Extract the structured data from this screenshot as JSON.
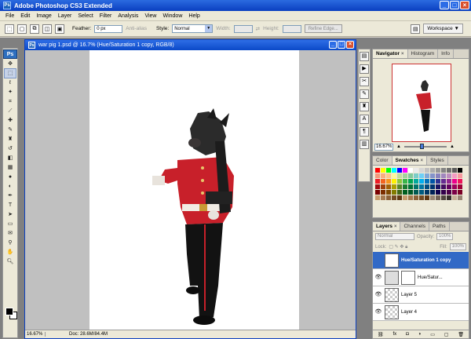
{
  "app": {
    "title": "Adobe Photoshop CS3 Extended",
    "icon": "Ps"
  },
  "menu": [
    "File",
    "Edit",
    "Image",
    "Layer",
    "Select",
    "Filter",
    "Analysis",
    "View",
    "Window",
    "Help"
  ],
  "options": {
    "feather_label": "Feather:",
    "feather_value": "0 px",
    "antialias_label": "Anti-alias",
    "style_label": "Style:",
    "style_value": "Normal",
    "width_label": "Width:",
    "height_label": "Height:",
    "refine_edge": "Refine Edge...",
    "workspace": "Workspace ▼"
  },
  "document": {
    "title": "war pig 1.psd @ 16.7% (Hue/Saturation 1 copy, RGB/8)",
    "zoom": "16.67%",
    "doc_size": "Doc: 28.6M/84.4M"
  },
  "navigator": {
    "tabs": [
      "Navigator",
      "Histogram",
      "Info"
    ],
    "zoom": "16.67%"
  },
  "swatches": {
    "tabs": [
      "Color",
      "Swatches",
      "Styles"
    ],
    "colors": [
      "#ff0000",
      "#ffff00",
      "#00ff00",
      "#00ffff",
      "#0000ff",
      "#ff00ff",
      "#ffffff",
      "#ebebeb",
      "#d6d6d6",
      "#c2c2c2",
      "#adadad",
      "#999999",
      "#858585",
      "#707070",
      "#5c5c5c",
      "#000000",
      "#f7977a",
      "#f9ad81",
      "#fdc68a",
      "#fff79a",
      "#c4df9b",
      "#a2d39c",
      "#82ca9d",
      "#7bcdc8",
      "#6ecff6",
      "#7ea7d8",
      "#8493ca",
      "#8882be",
      "#a187be",
      "#bc8dbf",
      "#f49ac2",
      "#f6989d",
      "#ed1c24",
      "#f26522",
      "#f7941d",
      "#fff200",
      "#8dc63f",
      "#39b54a",
      "#00a651",
      "#00a99d",
      "#00aeef",
      "#0072bc",
      "#0054a6",
      "#2e3192",
      "#662d91",
      "#92278f",
      "#ec008c",
      "#ed145b",
      "#9e0b0f",
      "#a0410d",
      "#a36209",
      "#aba000",
      "#598527",
      "#1a7b30",
      "#007236",
      "#00746b",
      "#0076a3",
      "#004b80",
      "#003471",
      "#1b1464",
      "#440e62",
      "#630460",
      "#9e005d",
      "#9e0039",
      "#790000",
      "#7b2e00",
      "#7d4900",
      "#827b00",
      "#406618",
      "#005e20",
      "#005826",
      "#005952",
      "#005b7f",
      "#003663",
      "#002157",
      "#0d004c",
      "#32004b",
      "#4b0049",
      "#7b0046",
      "#7a0026",
      "#c69c6d",
      "#a67c52",
      "#8c6239",
      "#754c24",
      "#603813",
      "#c69c6d",
      "#a67c52",
      "#8c6239",
      "#754c24",
      "#603813",
      "#998675",
      "#736357",
      "#534741",
      "#362f2d",
      "#c7b299",
      "#998675"
    ]
  },
  "layers": {
    "tabs": [
      "Layers",
      "Channels",
      "Paths"
    ],
    "blend_mode": "Normal",
    "opacity_label": "Opacity:",
    "opacity_value": "100%",
    "lock_label": "Lock:",
    "fill_label": "Fill:",
    "fill_value": "100%",
    "rows": [
      {
        "name": "Hue/Saturation 1 copy",
        "selected": true
      },
      {
        "name": "Hue/Satur...",
        "selected": false
      },
      {
        "name": "Layer 5",
        "selected": false
      },
      {
        "name": "Layer 4",
        "selected": false
      }
    ]
  }
}
